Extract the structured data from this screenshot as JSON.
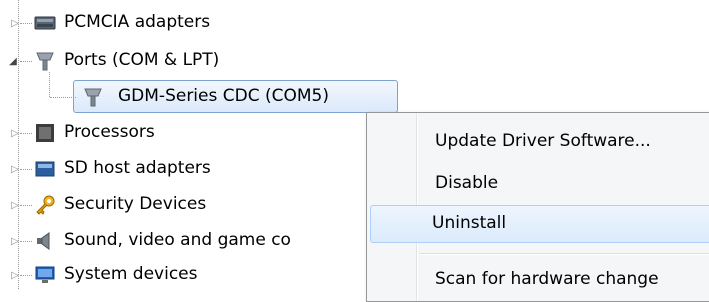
{
  "tree": {
    "items": [
      {
        "label": "PCMCIA adapters",
        "icon": "pcmcia-icon",
        "expander": "collapsed"
      },
      {
        "label": "Ports (COM & LPT)",
        "icon": "port-icon",
        "expander": "expanded"
      },
      {
        "label": "GDM-Series CDC (COM5)",
        "icon": "port-icon",
        "expander": "none",
        "selected": true
      },
      {
        "label": "Processors",
        "icon": "processor-icon",
        "expander": "collapsed"
      },
      {
        "label": "SD host adapters",
        "icon": "sd-host-icon",
        "expander": "collapsed"
      },
      {
        "label": "Security Devices",
        "icon": "security-key-icon",
        "expander": "collapsed"
      },
      {
        "label": "Sound, video and game co",
        "icon": "speaker-icon",
        "expander": "collapsed"
      },
      {
        "label": "System devices",
        "icon": "system-device-icon",
        "expander": "collapsed"
      }
    ]
  },
  "context_menu": {
    "items": [
      {
        "label": "Update Driver Software..."
      },
      {
        "label": "Disable"
      },
      {
        "label": "Uninstall",
        "highlighted": true
      },
      {
        "label": "Scan for hardware change"
      }
    ]
  },
  "colors": {
    "selection_border": "#7da2ce",
    "menu_background": "#f5f6f7",
    "menu_hover_border": "#aecff7"
  }
}
